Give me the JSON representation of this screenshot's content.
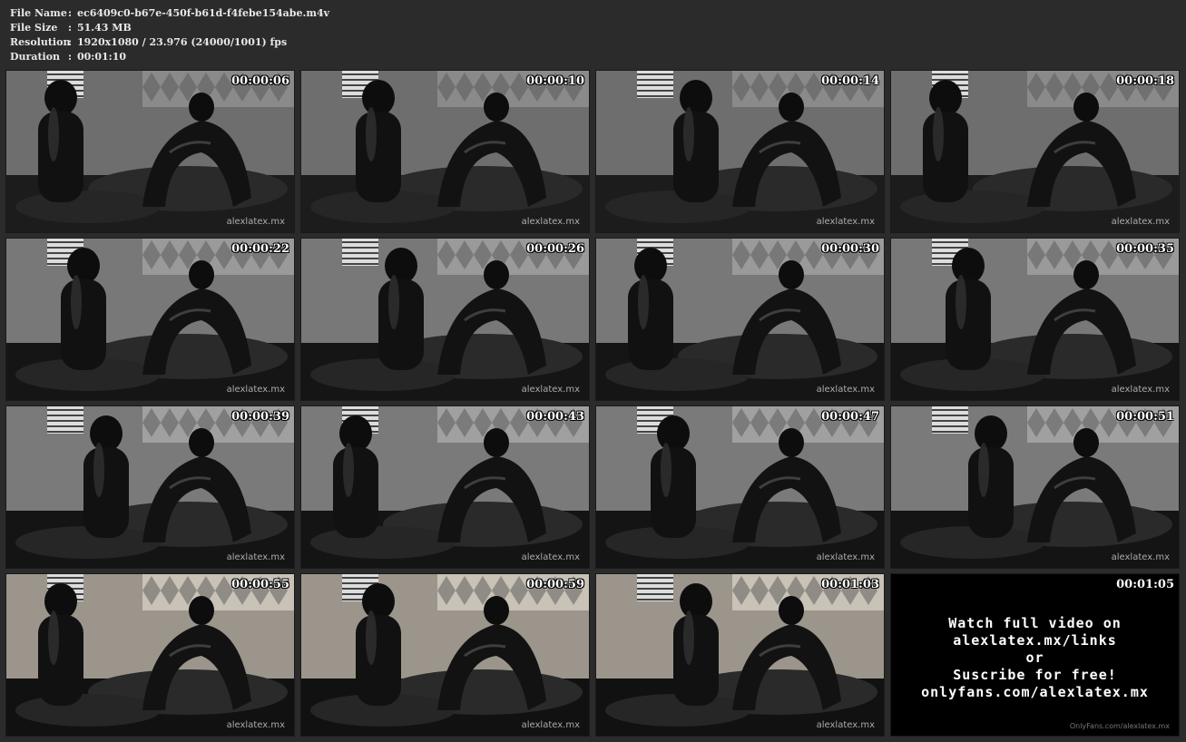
{
  "info": {
    "rows": [
      {
        "key": "File Name",
        "sep": ":",
        "value": "ec6409c0-b67e-450f-b61d-f4febe154abe.m4v"
      },
      {
        "key": "File Size",
        "sep": ":",
        "value": "51.43 MB"
      },
      {
        "key": "Resolution",
        "sep": ":",
        "value": "1920x1080 / 23.976 (24000/1001) fps"
      },
      {
        "key": "Duration",
        "sep": ":",
        "value": "00:01:10"
      }
    ]
  },
  "thumbnails": [
    {
      "time": "00:00:06",
      "watermark": "alexlatex.mx"
    },
    {
      "time": "00:00:10",
      "watermark": "alexlatex.mx"
    },
    {
      "time": "00:00:14",
      "watermark": "alexlatex.mx"
    },
    {
      "time": "00:00:18",
      "watermark": "alexlatex.mx"
    },
    {
      "time": "00:00:22",
      "watermark": "alexlatex.mx"
    },
    {
      "time": "00:00:26",
      "watermark": "alexlatex.mx"
    },
    {
      "time": "00:00:30",
      "watermark": "alexlatex.mx"
    },
    {
      "time": "00:00:35",
      "watermark": "alexlatex.mx"
    },
    {
      "time": "00:00:39",
      "watermark": "alexlatex.mx"
    },
    {
      "time": "00:00:43",
      "watermark": "alexlatex.mx"
    },
    {
      "time": "00:00:47",
      "watermark": "alexlatex.mx"
    },
    {
      "time": "00:00:51",
      "watermark": "alexlatex.mx"
    },
    {
      "time": "00:00:55",
      "watermark": "alexlatex.mx"
    },
    {
      "time": "00:00:59",
      "watermark": "alexlatex.mx"
    },
    {
      "time": "00:01:03",
      "watermark": "alexlatex.mx"
    }
  ],
  "promo": {
    "time": "00:01:05",
    "lines": [
      "Watch full video on",
      "alexlatex.mx/links",
      "or",
      "Suscribe for free!",
      "onlyfans.com/alexlatex.mx"
    ],
    "watermark": "OnlyFans.com/alexlatex.mx"
  }
}
